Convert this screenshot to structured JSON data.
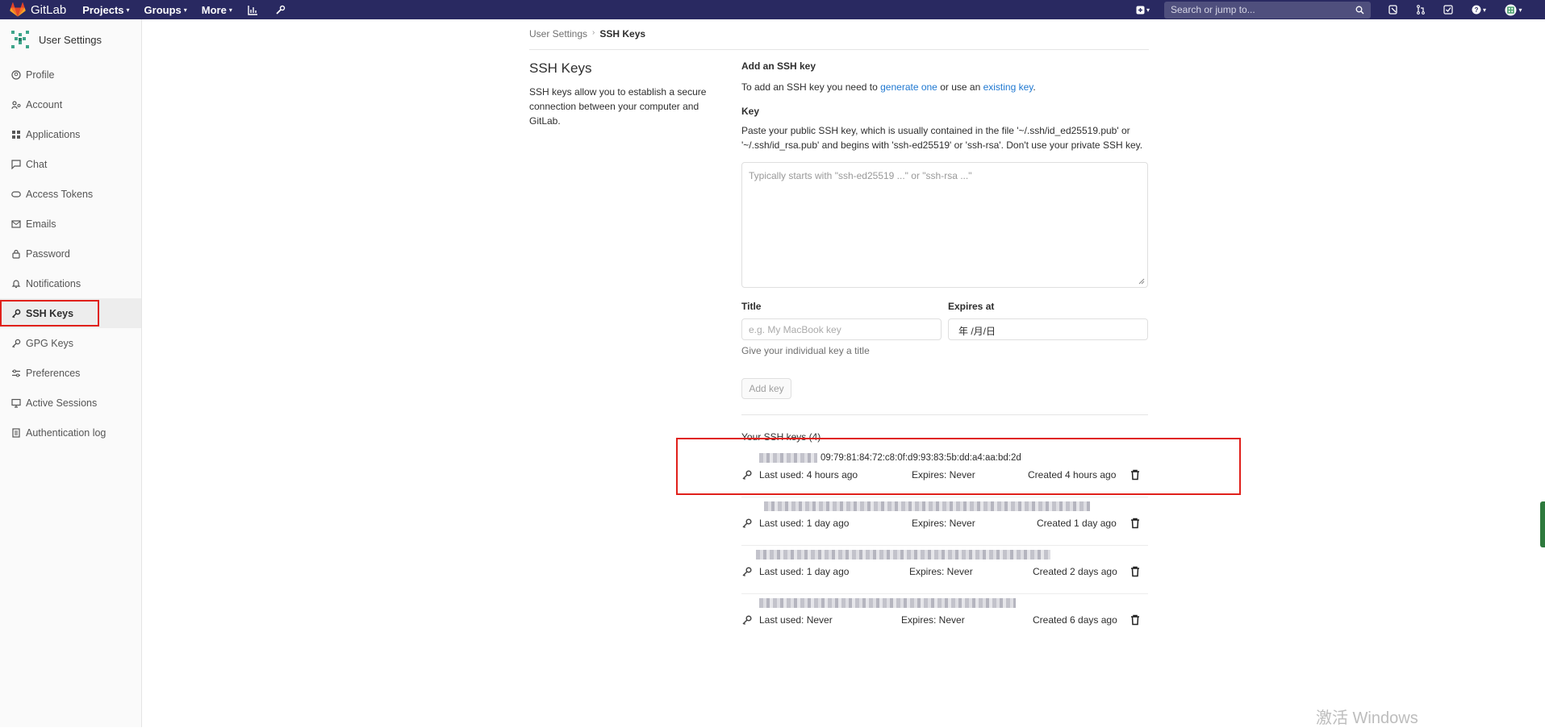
{
  "navbar": {
    "brand": "GitLab",
    "menu": [
      {
        "label": "Projects",
        "icon": "chevron-down-icon"
      },
      {
        "label": "Groups",
        "icon": "chevron-down-icon"
      },
      {
        "label": "More",
        "icon": "chevron-down-icon"
      }
    ],
    "search_placeholder": "Search or jump to...",
    "bg_color": "#292961"
  },
  "sidebar": {
    "title": "User Settings",
    "items": [
      {
        "label": "Profile",
        "icon": "user-icon"
      },
      {
        "label": "Account",
        "icon": "account-icon"
      },
      {
        "label": "Applications",
        "icon": "applications-icon"
      },
      {
        "label": "Chat",
        "icon": "chat-icon"
      },
      {
        "label": "Access Tokens",
        "icon": "token-icon"
      },
      {
        "label": "Emails",
        "icon": "mail-icon"
      },
      {
        "label": "Password",
        "icon": "lock-icon"
      },
      {
        "label": "Notifications",
        "icon": "bell-icon"
      },
      {
        "label": "SSH Keys",
        "icon": "key-icon",
        "active": true
      },
      {
        "label": "GPG Keys",
        "icon": "key-icon"
      },
      {
        "label": "Preferences",
        "icon": "preferences-icon"
      },
      {
        "label": "Active Sessions",
        "icon": "monitor-icon"
      },
      {
        "label": "Authentication log",
        "icon": "log-icon"
      }
    ]
  },
  "breadcrumb": {
    "parent": "User Settings",
    "current": "SSH Keys"
  },
  "intro": {
    "title": "SSH Keys",
    "description": "SSH keys allow you to establish a secure connection between your computer and GitLab."
  },
  "form": {
    "heading": "Add an SSH key",
    "help_prefix": "To add an SSH key you need to",
    "help_link1": "generate one",
    "help_middle": "or use an",
    "help_link2": "existing key",
    "help_suffix": ".",
    "key_label": "Key",
    "key_help": "Paste your public SSH key, which is usually contained in the file '~/.ssh/id_ed25519.pub' or '~/.ssh/id_rsa.pub' and begins with 'ssh-ed25519' or 'ssh-rsa'. Don't use your private SSH key.",
    "key_placeholder": "Typically starts with \"ssh-ed25519 ...\" or \"ssh-rsa ...\"",
    "title_label": "Title",
    "title_placeholder": "e.g. My MacBook key",
    "title_help": "Give your individual key a title",
    "expires_label": "Expires at",
    "expires_placeholder": "年 /月/日",
    "submit_label": "Add key"
  },
  "keys_heading": "Your SSH keys (4)",
  "keys": [
    {
      "fingerprint": "09:79:81:84:72:c8:0f:d9:93:83:5b:dd:a4:aa:bd:2d",
      "last_used": "Last used: 4 hours ago",
      "expires": "Expires: Never",
      "created": "Created 4 hours ago"
    },
    {
      "fingerprint": "",
      "last_used": "Last used: 1 day ago",
      "expires": "Expires: Never",
      "created": "Created 1 day ago"
    },
    {
      "fingerprint": "",
      "last_used": "Last used: 1 day ago",
      "expires": "Expires: Never",
      "created": "Created 2 days ago"
    },
    {
      "fingerprint": "",
      "last_used": "Last used: Never",
      "expires": "Expires: Never",
      "created": "Created 6 days ago"
    }
  ],
  "watermark": "激活 Windows"
}
